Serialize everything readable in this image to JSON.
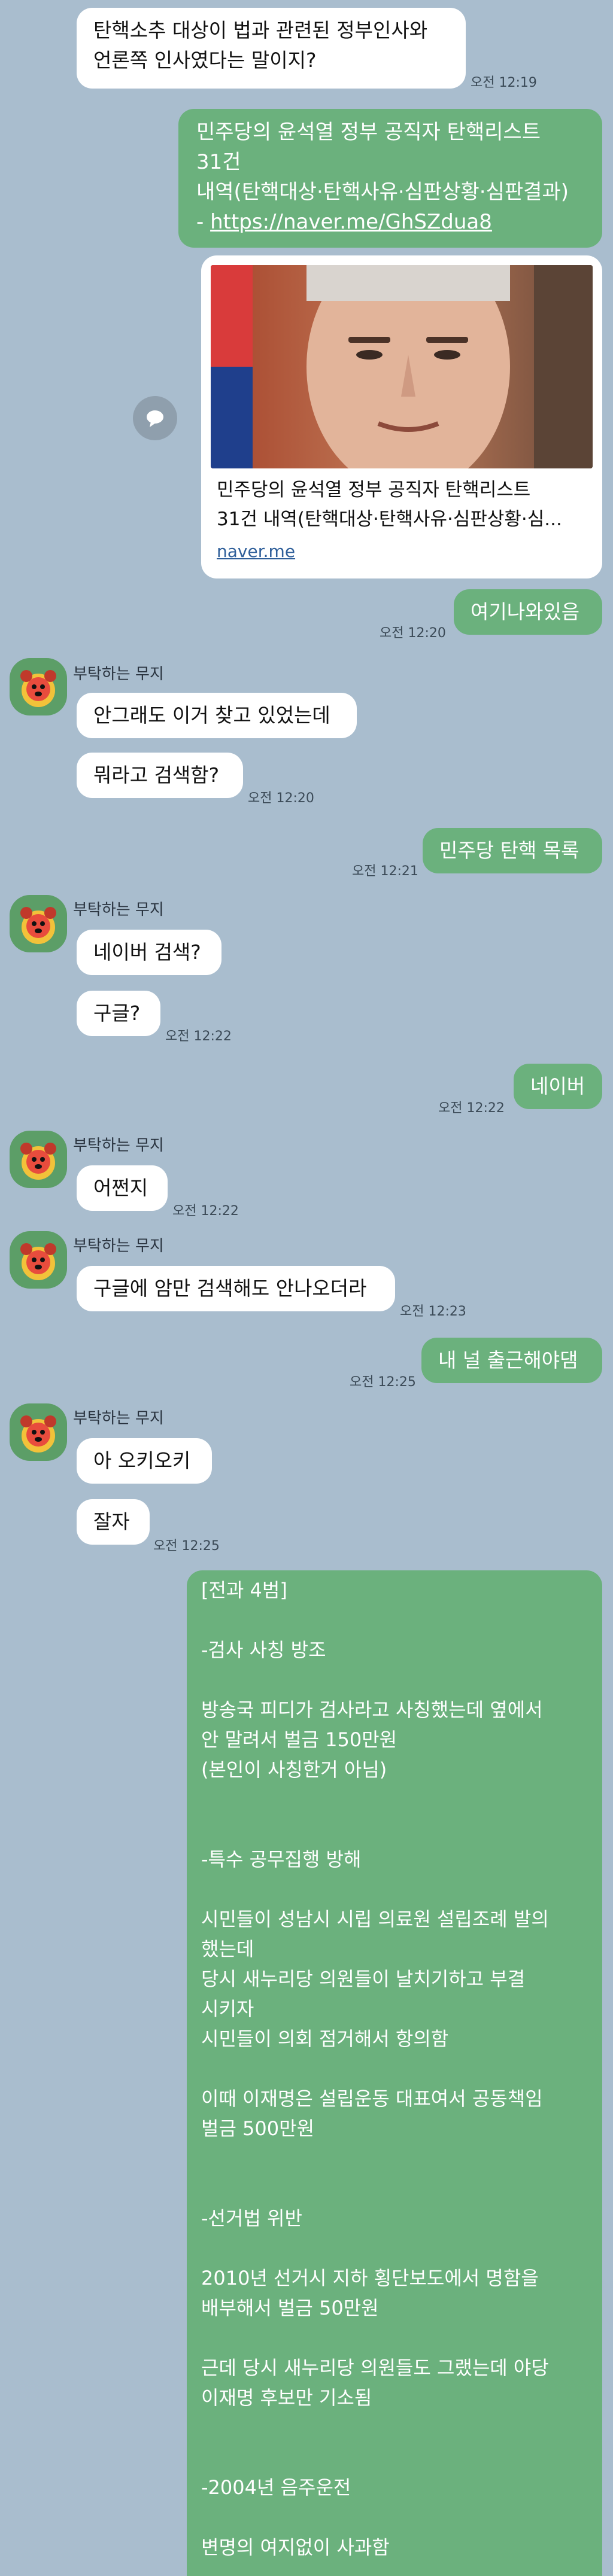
{
  "colors": {
    "background": "#a9bdce",
    "my_bubble": "#6bb17d",
    "their_bubble": "#ffffff"
  },
  "messages": {
    "m1": {
      "text": "탄핵소추 대상이 법과 관련된 정부인사와\n언론쪽 인사였다는 말이지?",
      "time": "오전 12:19"
    },
    "m2": {
      "line1": "민주당의 윤석열 정부 공직자 탄핵리스트",
      "line2": "31건",
      "line3": "내역(탄핵대상·탄핵사유·심판상황·심판결과)",
      "line4_prefix": "- ",
      "url": "https://naver.me/GhSZdua8"
    },
    "link_card": {
      "title_line1": "민주당의 윤석열 정부 공직자 탄핵리스트",
      "title_line2": "31건 내역(탄핵대상·탄핵사유·심판상황·심...",
      "domain": "naver.me",
      "share_icon": "share-icon"
    },
    "m3": {
      "text": "여기나와있음",
      "time": "오전 12:20"
    },
    "m4": {
      "sender": "부탁하는 무지",
      "text": "안그래도 이거 찾고 있었는데"
    },
    "m5": {
      "text": "뭐라고 검색함?",
      "time": "오전 12:20"
    },
    "m6": {
      "text": "민주당 탄핵 목록",
      "time": "오전 12:21"
    },
    "m7": {
      "sender": "부탁하는 무지",
      "text": "네이버 검색?"
    },
    "m8": {
      "text": "구글?",
      "time": "오전 12:22"
    },
    "m9": {
      "text": "네이버",
      "time": "오전 12:22"
    },
    "m10": {
      "sender": "부탁하는 무지",
      "text": "어쩐지",
      "time": "오전 12:22"
    },
    "m11": {
      "sender": "부탁하는 무지",
      "text": "구글에 암만 검색해도 안나오더라",
      "time": "오전 12:23"
    },
    "m12": {
      "text": "내 널 출근해야댐",
      "time": "오전 12:25"
    },
    "m13": {
      "sender": "부탁하는 무지",
      "text": "아 오키오키"
    },
    "m14": {
      "text": "잘자",
      "time": "오전 12:25"
    },
    "m15": {
      "text": "[전과 4범]\n\n-검사 사칭 방조\n\n방송국 피디가 검사라고 사칭했는데 옆에서\n안 말려서 벌금 150만원\n(본인이 사칭한거 아님)\n\n\n-특수 공무집행 방해\n\n시민들이 성남시 시립 의료원 설립조례 발의\n했는데\n당시 새누리당 의원들이 날치기하고 부결\n시키자\n시민들이 의회 점거해서 항의함\n\n이때 이재명은 설립운동 대표여서 공동책임\n벌금 500만원\n\n\n-선거법 위반\n\n2010년 선거시 지하 횡단보도에서 명함을\n배부해서 벌금 50만원\n\n근데 당시 새누리당 의원들도 그랬는데 야당\n이재명 후보만 기소됨\n\n\n-2004년 음주운전\n\n변명의 여지없이 사과함"
    }
  }
}
